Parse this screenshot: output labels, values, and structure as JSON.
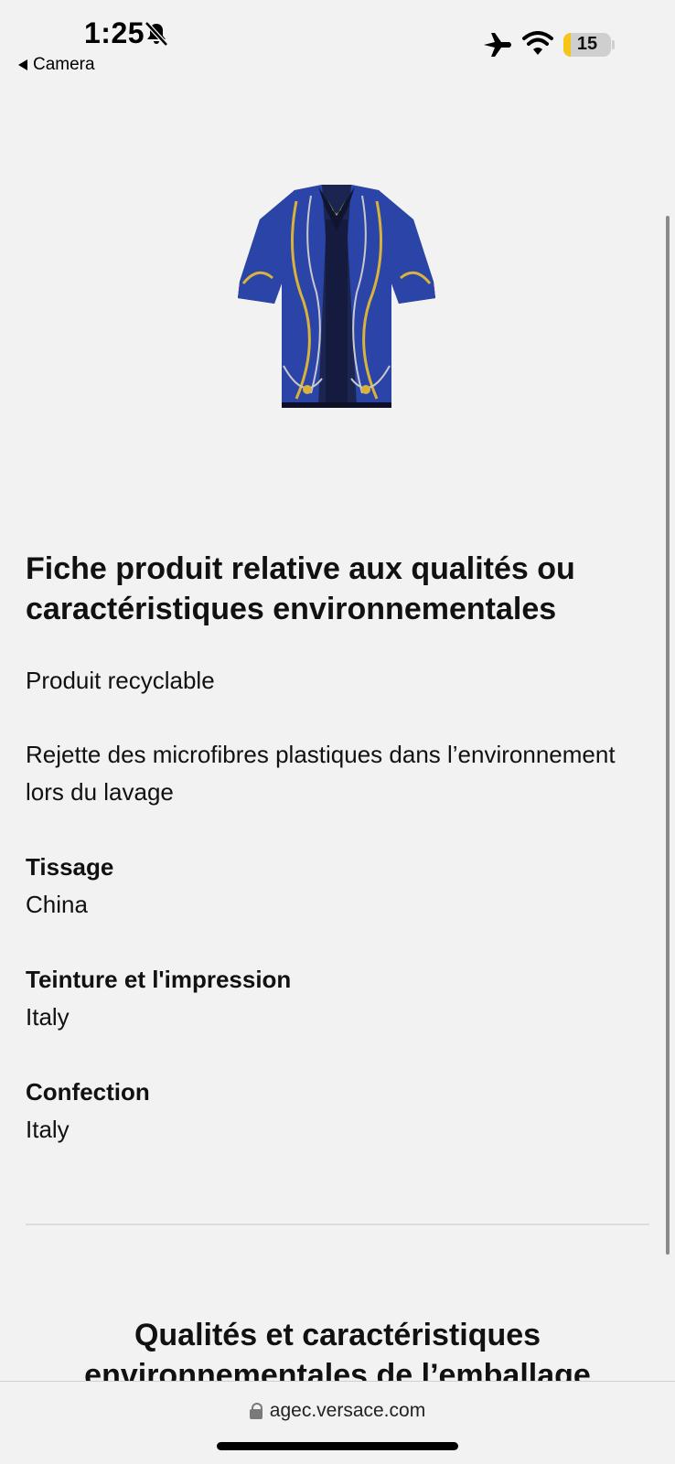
{
  "status_bar": {
    "time": "1:25",
    "back_label": "Camera",
    "battery_level": "15",
    "battery_fraction": 0.15
  },
  "product": {
    "image_icon": "shirt-image"
  },
  "environmental_sheet": {
    "title": "Fiche produit relative aux qualités ou caractéristiques environnementales",
    "attribute_1": "Produit recyclable",
    "attribute_2": "Rejette des microfibres plastiques dans l’environnement lors du lavage",
    "fields": [
      {
        "label": "Tissage",
        "value": "China"
      },
      {
        "label": "Teinture et l'impression",
        "value": "Italy"
      },
      {
        "label": "Confection",
        "value": "Italy"
      }
    ]
  },
  "packaging_section": {
    "title": "Qualités et caractéristiques environnementales de l’emballage"
  },
  "browser": {
    "url": "agec.versace.com"
  },
  "colors": {
    "background": "#f2f2f2",
    "battery_fill": "#f5c518",
    "shirt_navy": "#1b2550",
    "shirt_blue": "#2b44a8",
    "print_gold": "#d8b23a"
  }
}
